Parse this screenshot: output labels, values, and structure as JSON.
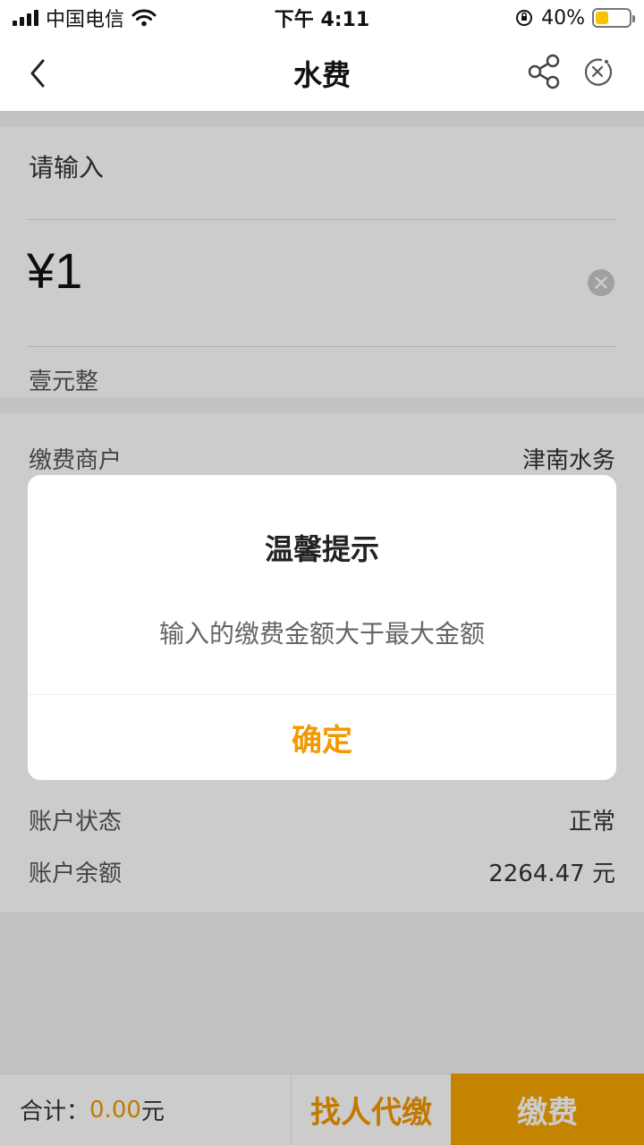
{
  "status_bar": {
    "carrier": "中国电信",
    "time": "下午 4:11",
    "battery_percent": "40%",
    "battery_level": 0.4
  },
  "nav": {
    "title": "水费",
    "back_icon": "chevron-left-icon",
    "share_icon": "share-icon",
    "close_icon": "close-circle-icon"
  },
  "amount_card": {
    "prompt": "请输入",
    "amount": "¥1",
    "amount_words": "壹元整"
  },
  "info": {
    "rows": [
      {
        "label": "缴费商户",
        "value": "津南水务"
      },
      {
        "label": "账户状态",
        "value": "正常"
      },
      {
        "label": "账户余额",
        "value": "2264.47 元"
      }
    ]
  },
  "bottom_bar": {
    "total_label": "合计：",
    "total_amount": "0.00",
    "total_unit": "元",
    "proxy_label": "找人代缴",
    "pay_label": "缴费"
  },
  "dialog": {
    "title": "温馨提示",
    "message": "输入的缴费金额大于最大金额",
    "ok_label": "确定"
  },
  "colors": {
    "accent": "#f39800",
    "pay_button": "#f7a600"
  }
}
